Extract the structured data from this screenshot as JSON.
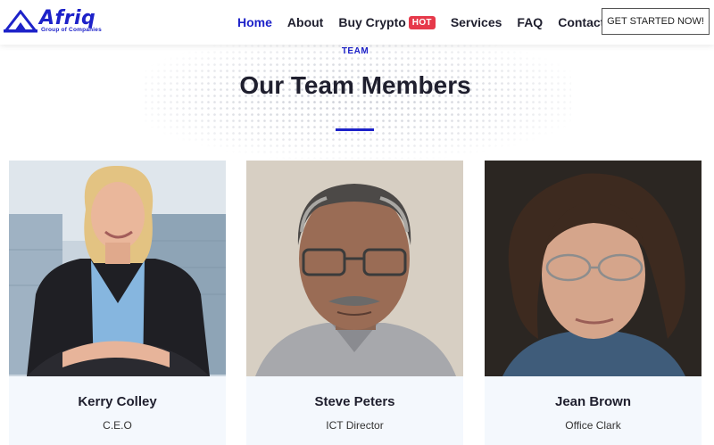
{
  "header": {
    "logo": {
      "name": "Afriq",
      "tagline": "Group of Companies"
    },
    "nav": [
      {
        "label": "Home",
        "active": true
      },
      {
        "label": "About"
      },
      {
        "label": "Buy Crypto",
        "badge": "HOT"
      },
      {
        "label": "Services"
      },
      {
        "label": "FAQ"
      },
      {
        "label": "Contact"
      }
    ],
    "cta_label": "GET STARTED NOW!"
  },
  "section": {
    "kicker": "TEAM",
    "title": "Our Team Members"
  },
  "team": [
    {
      "name": "Kerry Colley",
      "role": "C.E.O"
    },
    {
      "name": "Steve Peters",
      "role": "ICT Director"
    },
    {
      "name": "Jean Brown",
      "role": "Office Clark"
    }
  ],
  "colors": {
    "brand": "#1d22c9",
    "hot_badge": "#e6394a",
    "card_bg": "#f4f8fd",
    "heading": "#1f1f2e"
  }
}
